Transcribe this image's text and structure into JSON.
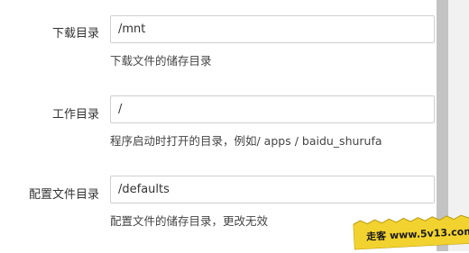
{
  "form": {
    "fields": [
      {
        "label": "下载目录",
        "value": "/mnt",
        "help": "下载文件的储存目录"
      },
      {
        "label": "工作目录",
        "value": "/",
        "help": "程序启动时打开的目录，例如/ apps / baidu_shurufa"
      },
      {
        "label": "配置文件目录",
        "value": "/defaults",
        "help": "配置文件的储存目录，更改无效"
      }
    ]
  },
  "watermark": {
    "text": "走客 www.5v13.com",
    "color": "#f2d22e"
  }
}
